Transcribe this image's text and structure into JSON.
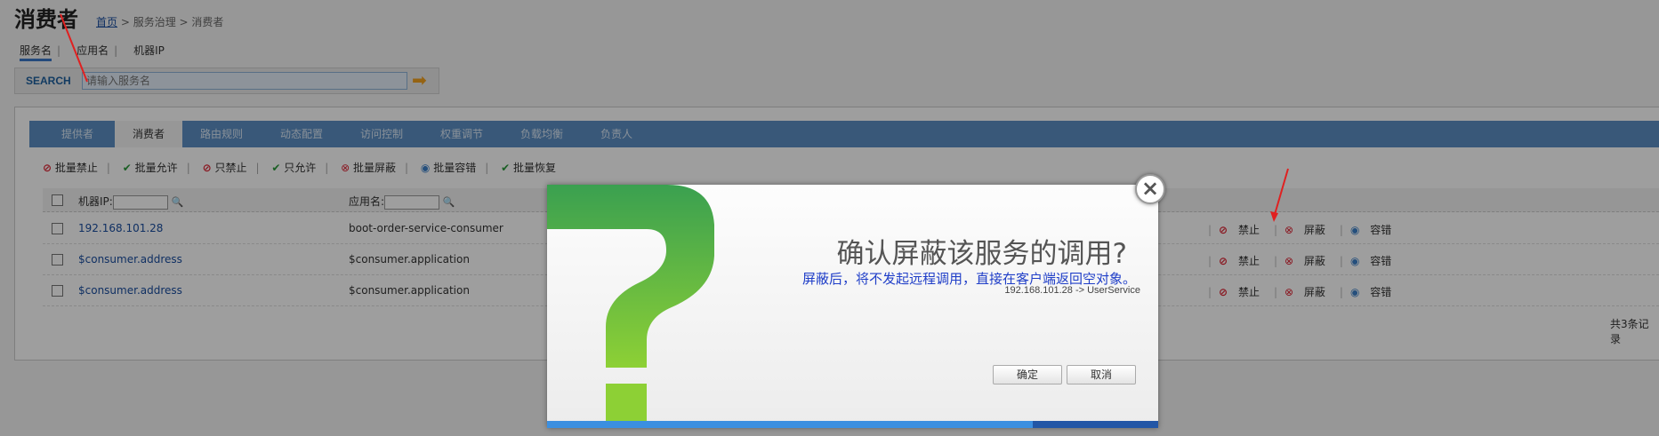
{
  "page": {
    "title": "消费者",
    "breadcrumb": {
      "home": "首页",
      "sep": " > ",
      "mid": "服务治理",
      "current": "消费者"
    }
  },
  "search_tabs": [
    "服务名",
    "应用名",
    "机器IP"
  ],
  "search": {
    "label": "SEARCH",
    "placeholder": "请输入服务名"
  },
  "main_tabs": [
    "提供者",
    "消费者",
    "路由规则",
    "动态配置",
    "访问控制",
    "权重调节",
    "负载均衡",
    "负责人"
  ],
  "active_tab": "消费者",
  "batch_actions": [
    {
      "icon": "forbid-icon",
      "label": "批量禁止"
    },
    {
      "icon": "check-icon",
      "label": "批量允许"
    },
    {
      "icon": "forbid-icon",
      "label": "只禁止"
    },
    {
      "icon": "check-icon",
      "label": "只允许"
    },
    {
      "icon": "shield-icon",
      "label": "批量屏蔽"
    },
    {
      "icon": "tolerate-icon",
      "label": "批量容错"
    },
    {
      "icon": "check-icon",
      "label": "批量恢复"
    }
  ],
  "table": {
    "headers": {
      "ip": "机器IP:",
      "app": "应用名:"
    },
    "rows": [
      {
        "ip": "192.168.101.28",
        "app": "boot-order-service-consumer"
      },
      {
        "ip": "$consumer.address",
        "app": "$consumer.application"
      },
      {
        "ip": "$consumer.address",
        "app": "$consumer.application"
      }
    ],
    "row_ops": [
      "禁止",
      "屏蔽",
      "容错"
    ],
    "count_text": "共3条记录"
  },
  "dialog": {
    "title": "确认屏蔽该服务的调用?",
    "subtitle": "屏蔽后，将不发起远程调用，直接在客户端返回空对象。",
    "service": "192.168.101.28 -> UserService",
    "ok": "确定",
    "cancel": "取消"
  },
  "colors": {
    "tab_bar": "#5c8fc4",
    "link": "#1a4ea0",
    "dialog_green": "#7cc243",
    "dialog_blue": "#1f3ec8"
  }
}
